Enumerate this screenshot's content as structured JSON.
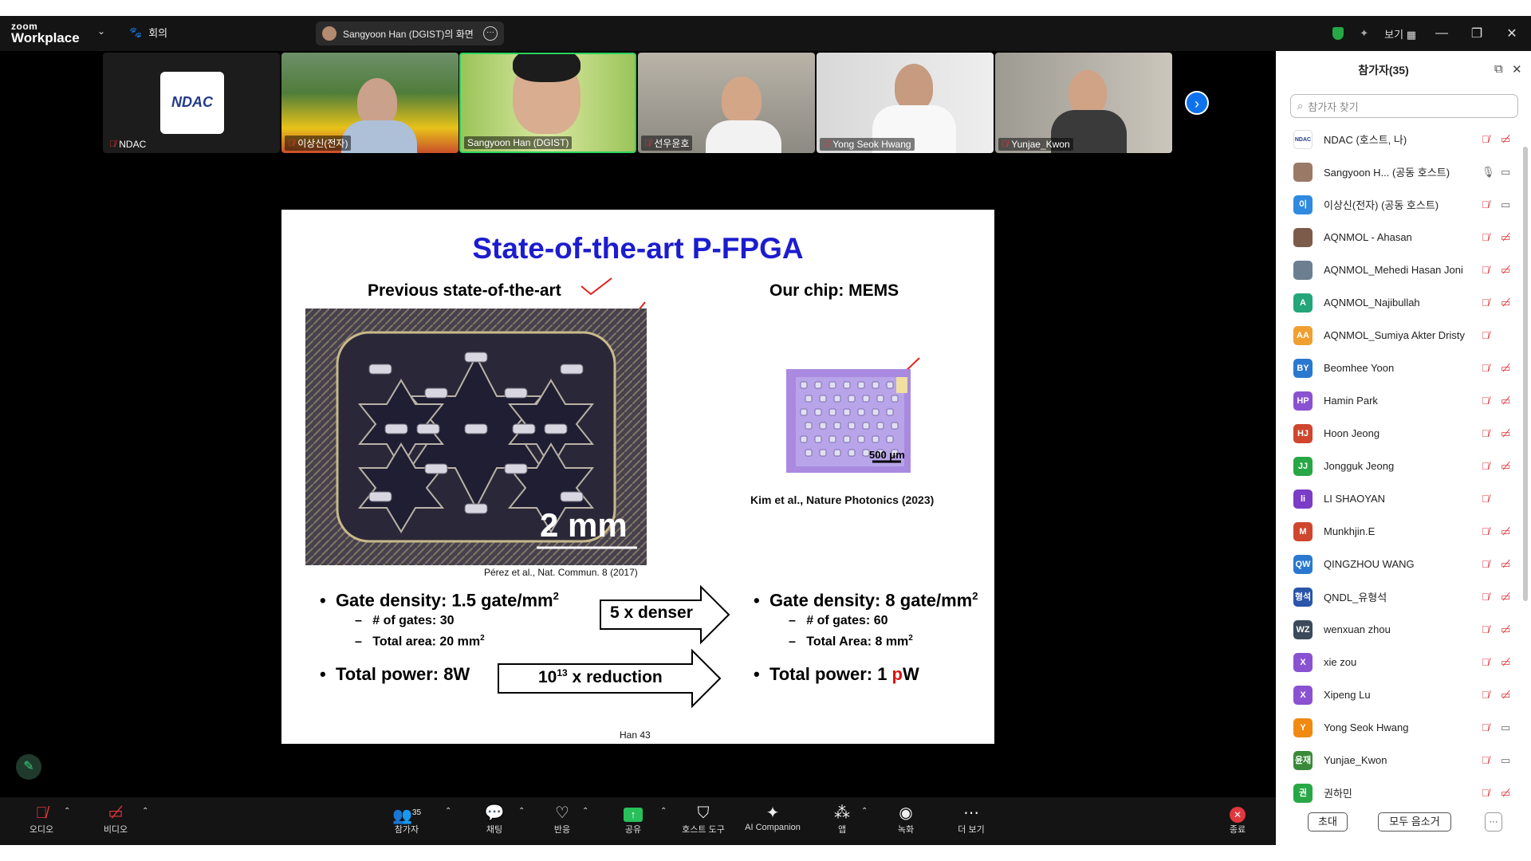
{
  "app": {
    "logo_top": "zoom",
    "logo_bottom": "Workplace",
    "meeting_label": "회의",
    "share_pill": "Sangyoon Han (DGIST)의 화면",
    "view_label": "보기",
    "accent": "#0e72ed"
  },
  "gallery": [
    {
      "name": "NDAC",
      "mic": "off"
    },
    {
      "name": "이상신(전자)",
      "mic": "off"
    },
    {
      "name": "Sangyoon Han (DGIST)",
      "mic": "on",
      "active": true
    },
    {
      "name": "선우윤호",
      "mic": "off"
    },
    {
      "name": "Yong Seok Hwang",
      "mic": "off"
    },
    {
      "name": "Yunjae_Kwon",
      "mic": "off"
    }
  ],
  "ndac_logo": "NDAC",
  "slide": {
    "title": "State-of-the-art P-FPGA",
    "left_heading": "Previous state-of-the-art",
    "right_heading": "Our chip: MEMS",
    "scale_left": "2 mm",
    "cite_left": "Pérez et al., Nat. Commun. 8 (2017)",
    "scale_right": "500 μm",
    "cite_right": "Kim et al., Nature Photonics (2023)",
    "left_bullets": {
      "gate_density": "Gate density: 1.5 gate/mm",
      "num_gates": "# of gates: 30",
      "total_area": "Total area: 20 mm",
      "total_power": "Total power: 8W"
    },
    "right_bullets": {
      "gate_density": "Gate density: 8 gate/mm",
      "num_gates": "# of gates: 60",
      "total_area": "Total Area:  8 mm",
      "total_power_prefix": "Total power: 1 ",
      "total_power_unit_red": "p",
      "total_power_unit": "W"
    },
    "superscript_2": "2",
    "arrow1": "5 x denser",
    "arrow2_base": "10",
    "arrow2_exp": "13",
    "arrow2_rest": " x reduction",
    "page_num": "Han 43"
  },
  "panel": {
    "title": "참가자(35)",
    "search_placeholder": "참가자 찾기",
    "participants": [
      {
        "name": "NDAC (호스트, 나)",
        "initials": "",
        "color": "#ffffff",
        "mic": "off",
        "cam": "off"
      },
      {
        "name": "Sangyoon H...  (공동 호스트)",
        "initials": "",
        "color": "#9a7a66",
        "mic": "on",
        "cam": "on"
      },
      {
        "name": "이상신(전자) (공동 호스트)",
        "initials": "이",
        "color": "#2f8ae0",
        "mic": "off",
        "cam": "on"
      },
      {
        "name": "AQNMOL - Ahasan",
        "initials": "",
        "color": "#7d5b4a",
        "mic": "off",
        "cam": "off"
      },
      {
        "name": "AQNMOL_Mehedi Hasan Joni",
        "initials": "",
        "color": "#6b7f90",
        "mic": "off",
        "cam": "off"
      },
      {
        "name": "AQNMOL_Najibullah",
        "initials": "A",
        "color": "#22a67a",
        "mic": "off",
        "cam": "off"
      },
      {
        "name": "AQNMOL_Sumiya Akter Dristy",
        "initials": "AA",
        "color": "#f0a030",
        "mic": "off",
        "cam": ""
      },
      {
        "name": "Beomhee Yoon",
        "initials": "BY",
        "color": "#2a78d0",
        "mic": "off",
        "cam": "off"
      },
      {
        "name": "Hamin Park",
        "initials": "HP",
        "color": "#8a52d0",
        "mic": "off",
        "cam": "off"
      },
      {
        "name": "Hoon Jeong",
        "initials": "HJ",
        "color": "#d0452e",
        "mic": "off",
        "cam": "off"
      },
      {
        "name": "Jongguk Jeong",
        "initials": "JJ",
        "color": "#27a745",
        "mic": "off",
        "cam": "off"
      },
      {
        "name": "LI SHAOYAN",
        "initials": "li",
        "color": "#7b3cc7",
        "mic": "off",
        "cam": ""
      },
      {
        "name": "Munkhjin.E",
        "initials": "M",
        "color": "#d0452e",
        "mic": "off",
        "cam": "off"
      },
      {
        "name": "QINGZHOU WANG",
        "initials": "QW",
        "color": "#2a78d0",
        "mic": "off",
        "cam": "off"
      },
      {
        "name": "QNDL_유형석",
        "initials": "형석",
        "color": "#2a55a8",
        "mic": "off",
        "cam": "off"
      },
      {
        "name": "wenxuan zhou",
        "initials": "WZ",
        "color": "#3a4a5a",
        "mic": "off",
        "cam": "off"
      },
      {
        "name": "xie zou",
        "initials": "X",
        "color": "#8a52d0",
        "mic": "off",
        "cam": "off"
      },
      {
        "name": "Xipeng Lu",
        "initials": "X",
        "color": "#8a52d0",
        "mic": "off",
        "cam": "off"
      },
      {
        "name": "Yong Seok Hwang",
        "initials": "Y",
        "color": "#f08a10",
        "mic": "off",
        "cam": "on"
      },
      {
        "name": "Yunjae_Kwon",
        "initials": "윤재",
        "color": "#3a8a3a",
        "mic": "off",
        "cam": "on"
      },
      {
        "name": "권하민",
        "initials": "권",
        "color": "#27a745",
        "mic": "off",
        "cam": "off"
      }
    ],
    "invite_label": "초대",
    "mute_all_label": "모두 음소거",
    "more_label": "···"
  },
  "toolbar": {
    "audio": "오디오",
    "video": "비디오",
    "participants": "참가자",
    "participants_count": "35",
    "chat": "채팅",
    "react": "반응",
    "share": "공유",
    "host_tools": "호스트 도구",
    "ai": "AI Companion",
    "apps": "앱",
    "record": "녹화",
    "more": "더 보기",
    "end": "종료"
  }
}
